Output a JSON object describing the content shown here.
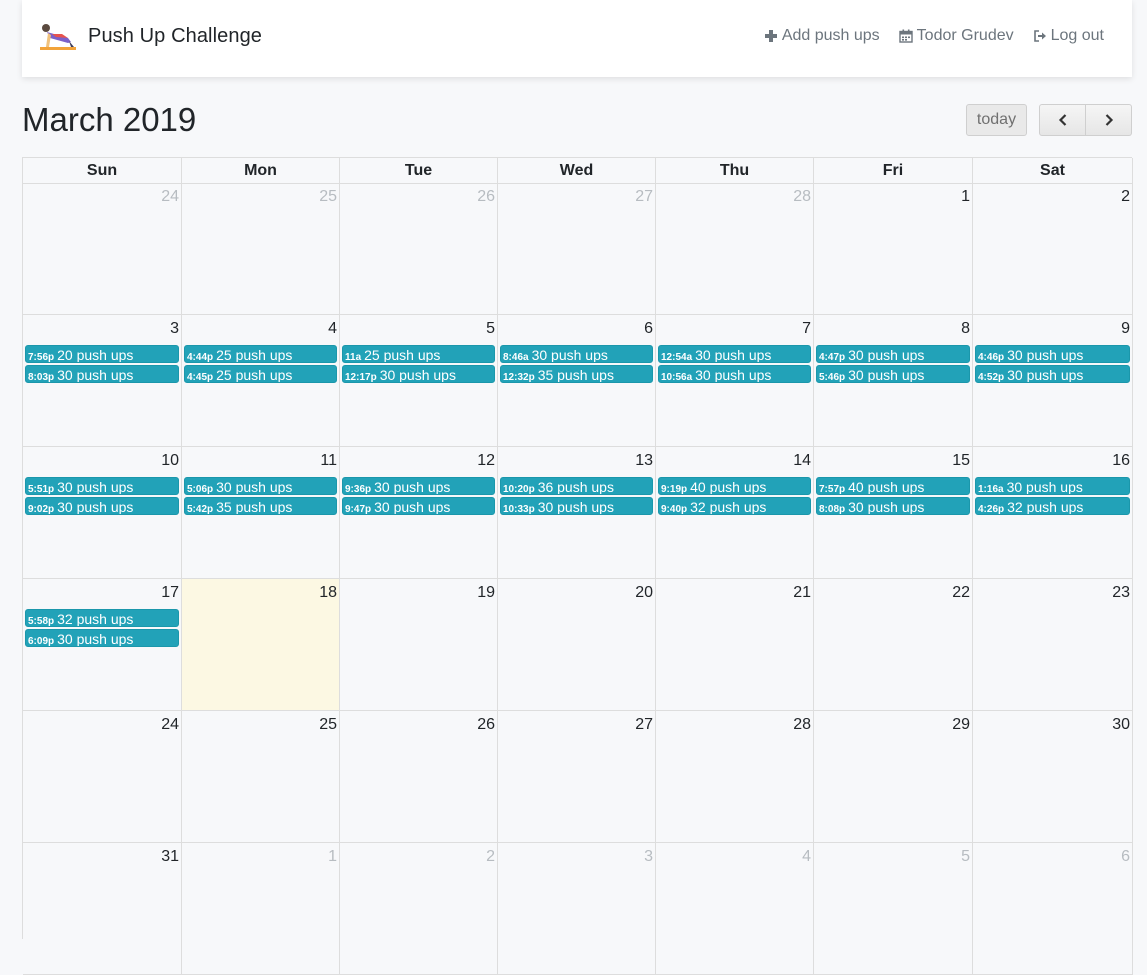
{
  "navbar": {
    "brand_title": "Push Up Challenge",
    "links": [
      {
        "label": "Add push ups",
        "icon": "plus-icon"
      },
      {
        "label": "Todor Grudev",
        "icon": "calendar-icon"
      },
      {
        "label": "Log out",
        "icon": "logout-icon"
      }
    ]
  },
  "toolbar": {
    "title": "March 2019",
    "today_label": "today",
    "prev_icon": "chevron-left-icon",
    "next_icon": "chevron-right-icon"
  },
  "colors": {
    "event_bg": "#22a2b8",
    "today_bg": "#fcf8e3"
  },
  "calendar": {
    "weekdays": [
      "Sun",
      "Mon",
      "Tue",
      "Wed",
      "Thu",
      "Fri",
      "Sat"
    ],
    "weeks": [
      [
        {
          "day": "24",
          "other": true,
          "events": []
        },
        {
          "day": "25",
          "other": true,
          "events": []
        },
        {
          "day": "26",
          "other": true,
          "events": []
        },
        {
          "day": "27",
          "other": true,
          "events": []
        },
        {
          "day": "28",
          "other": true,
          "events": []
        },
        {
          "day": "1",
          "events": []
        },
        {
          "day": "2",
          "events": []
        }
      ],
      [
        {
          "day": "3",
          "events": [
            {
              "time": "7:56p",
              "title": "20 push ups"
            },
            {
              "time": "8:03p",
              "title": "30 push ups"
            }
          ]
        },
        {
          "day": "4",
          "events": [
            {
              "time": "4:44p",
              "title": "25 push ups"
            },
            {
              "time": "4:45p",
              "title": "25 push ups"
            }
          ]
        },
        {
          "day": "5",
          "events": [
            {
              "time": "11a",
              "title": "25 push ups"
            },
            {
              "time": "12:17p",
              "title": "30 push ups"
            }
          ]
        },
        {
          "day": "6",
          "events": [
            {
              "time": "8:46a",
              "title": "30 push ups"
            },
            {
              "time": "12:32p",
              "title": "35 push ups"
            }
          ]
        },
        {
          "day": "7",
          "events": [
            {
              "time": "12:54a",
              "title": "30 push ups"
            },
            {
              "time": "10:56a",
              "title": "30 push ups"
            }
          ]
        },
        {
          "day": "8",
          "events": [
            {
              "time": "4:47p",
              "title": "30 push ups"
            },
            {
              "time": "5:46p",
              "title": "30 push ups"
            }
          ]
        },
        {
          "day": "9",
          "events": [
            {
              "time": "4:46p",
              "title": "30 push ups"
            },
            {
              "time": "4:52p",
              "title": "30 push ups"
            }
          ]
        }
      ],
      [
        {
          "day": "10",
          "events": [
            {
              "time": "5:51p",
              "title": "30 push ups"
            },
            {
              "time": "9:02p",
              "title": "30 push ups"
            }
          ]
        },
        {
          "day": "11",
          "events": [
            {
              "time": "5:06p",
              "title": "30 push ups"
            },
            {
              "time": "5:42p",
              "title": "35 push ups"
            }
          ]
        },
        {
          "day": "12",
          "events": [
            {
              "time": "9:36p",
              "title": "30 push ups"
            },
            {
              "time": "9:47p",
              "title": "30 push ups"
            }
          ]
        },
        {
          "day": "13",
          "events": [
            {
              "time": "10:20p",
              "title": "36 push ups"
            },
            {
              "time": "10:33p",
              "title": "30 push ups"
            }
          ]
        },
        {
          "day": "14",
          "events": [
            {
              "time": "9:19p",
              "title": "40 push ups"
            },
            {
              "time": "9:40p",
              "title": "32 push ups"
            }
          ]
        },
        {
          "day": "15",
          "events": [
            {
              "time": "7:57p",
              "title": "40 push ups"
            },
            {
              "time": "8:08p",
              "title": "30 push ups"
            }
          ]
        },
        {
          "day": "16",
          "events": [
            {
              "time": "1:16a",
              "title": "30 push ups"
            },
            {
              "time": "4:26p",
              "title": "32 push ups"
            }
          ]
        }
      ],
      [
        {
          "day": "17",
          "events": [
            {
              "time": "5:58p",
              "title": "32 push ups"
            },
            {
              "time": "6:09p",
              "title": "30 push ups"
            }
          ]
        },
        {
          "day": "18",
          "today": true,
          "events": []
        },
        {
          "day": "19",
          "events": []
        },
        {
          "day": "20",
          "events": []
        },
        {
          "day": "21",
          "events": []
        },
        {
          "day": "22",
          "events": []
        },
        {
          "day": "23",
          "events": []
        }
      ],
      [
        {
          "day": "24",
          "events": []
        },
        {
          "day": "25",
          "events": []
        },
        {
          "day": "26",
          "events": []
        },
        {
          "day": "27",
          "events": []
        },
        {
          "day": "28",
          "events": []
        },
        {
          "day": "29",
          "events": []
        },
        {
          "day": "30",
          "events": []
        }
      ],
      [
        {
          "day": "31",
          "events": []
        },
        {
          "day": "1",
          "other": true,
          "events": []
        },
        {
          "day": "2",
          "other": true,
          "events": []
        },
        {
          "day": "3",
          "other": true,
          "events": []
        },
        {
          "day": "4",
          "other": true,
          "events": []
        },
        {
          "day": "5",
          "other": true,
          "events": []
        },
        {
          "day": "6",
          "other": true,
          "events": []
        }
      ]
    ]
  }
}
